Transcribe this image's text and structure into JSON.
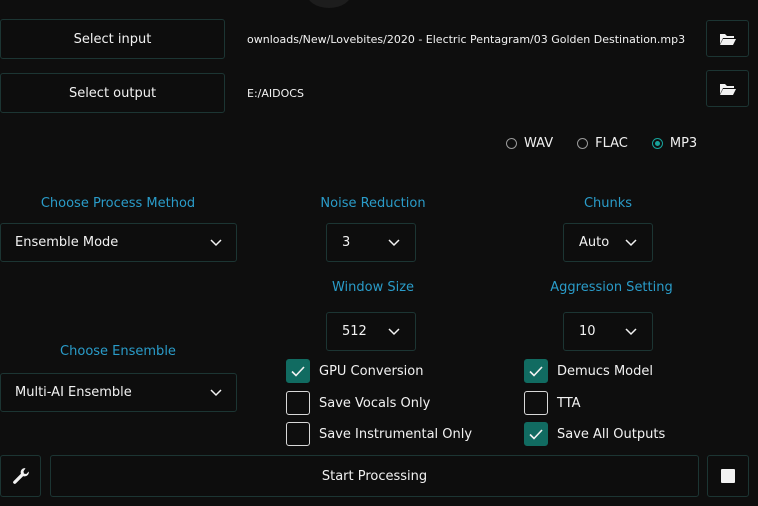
{
  "io": {
    "select_input_label": "Select input",
    "input_path": "ownloads/New/Lovebites/2020 - Electric Pentagram/03 Golden Destination.mp3",
    "select_output_label": "Select output",
    "output_path": "E:/AIDOCS"
  },
  "format": {
    "options": [
      "WAV",
      "FLAC",
      "MP3"
    ],
    "selected": "MP3"
  },
  "process_method": {
    "label": "Choose Process Method",
    "value": "Ensemble Mode"
  },
  "ensemble": {
    "label": "Choose Ensemble",
    "value": "Multi-AI Ensemble"
  },
  "noise_reduction": {
    "label": "Noise Reduction",
    "value": "3"
  },
  "window_size": {
    "label": "Window Size",
    "value": "512"
  },
  "chunks": {
    "label": "Chunks",
    "value": "Auto"
  },
  "aggression": {
    "label": "Aggression Setting",
    "value": "10"
  },
  "options": {
    "gpu_conversion": {
      "label": "GPU Conversion",
      "checked": true
    },
    "save_vocals_only": {
      "label": "Save Vocals Only",
      "checked": false
    },
    "save_instrumental_only": {
      "label": "Save Instrumental Only",
      "checked": false
    },
    "demucs_model": {
      "label": "Demucs Model",
      "checked": true
    },
    "tta": {
      "label": "TTA",
      "checked": false
    },
    "save_all_outputs": {
      "label": "Save All Outputs",
      "checked": true
    }
  },
  "footer": {
    "start_label": "Start Processing"
  },
  "colors": {
    "accent_label": "#2a9cc9",
    "check_fill": "#116b61",
    "border": "#1c3533"
  },
  "icons": {
    "folder": "folder-open-icon",
    "wrench": "wrench-icon",
    "stop": "stop-icon",
    "chevron": "chevron-down-icon"
  }
}
